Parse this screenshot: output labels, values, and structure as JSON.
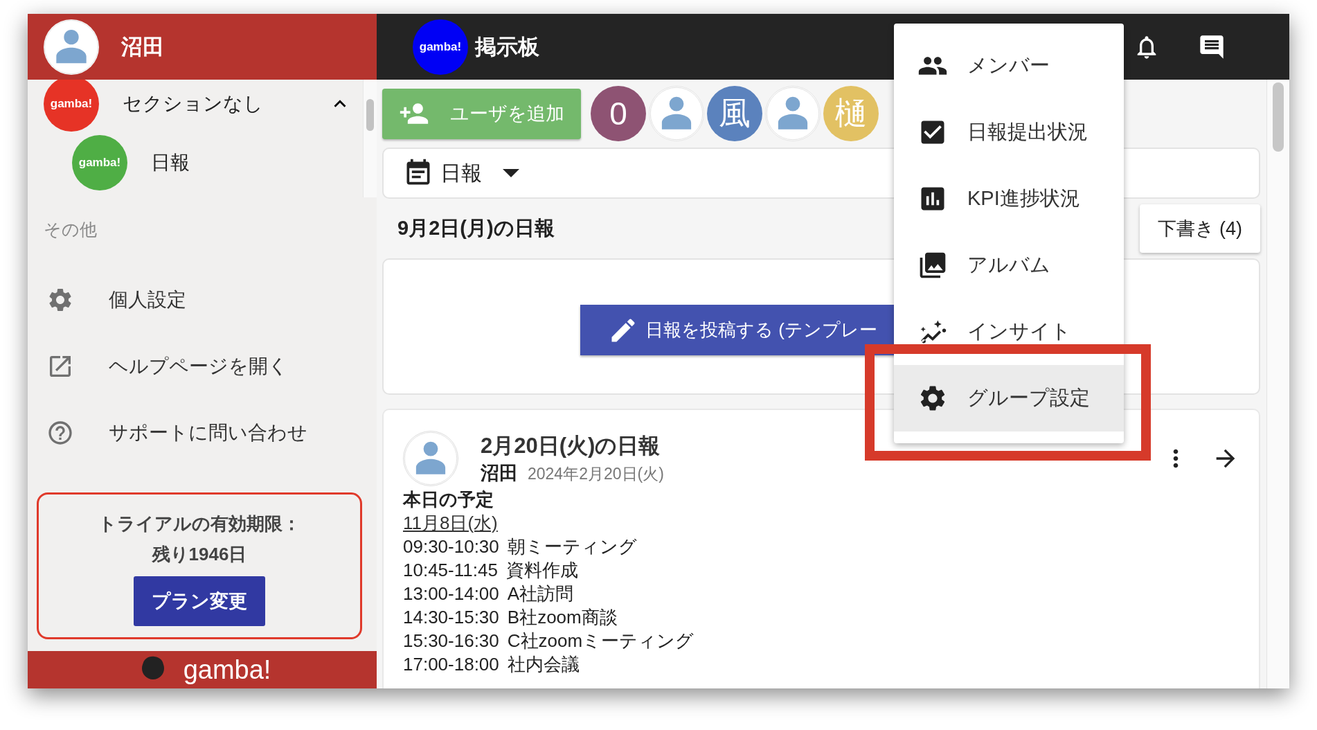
{
  "sidebar": {
    "user": {
      "name": "沼田"
    },
    "sections": [
      {
        "logo": "gamba!",
        "color": "#e63326",
        "label": "セクションなし",
        "expanded": true,
        "children": [
          {
            "logo": "gamba!",
            "color": "#4fae45",
            "label": "日報"
          }
        ]
      }
    ],
    "other_heading": "その他",
    "links": [
      {
        "label": "個人設定"
      },
      {
        "label": "ヘルプページを開く"
      },
      {
        "label": "サポートに問い合わせ"
      }
    ],
    "trial": {
      "lines": [
        "トライアルの有効期限：",
        "残り1946日"
      ],
      "button": "プラン変更"
    },
    "footer": {
      "brand": "gamba!"
    }
  },
  "header": {
    "logo": "gamba!",
    "title": "掲示板"
  },
  "toolbar": {
    "add_user": "ユーザを追加",
    "members": [
      {
        "kind": "letter",
        "text": "0",
        "color": "#8e5373"
      },
      {
        "kind": "image"
      },
      {
        "kind": "letter",
        "text": "風",
        "color": "#5b82bd"
      },
      {
        "kind": "image"
      },
      {
        "kind": "letter",
        "text": "樋",
        "color": "#e2c163"
      }
    ]
  },
  "filter": {
    "label": "日報"
  },
  "day": {
    "title": "9月2日(月)の日報",
    "drafts": "下書き (4)",
    "post_button": "日報を投稿する (テンプレー"
  },
  "entries": [
    {
      "title": "2月20日(火)の日報",
      "author": "沼田",
      "date": "2024年2月20日(火)",
      "heading": "本日の予定",
      "date_link": "11月8日(水)",
      "schedule": [
        {
          "time": "09:30-10:30",
          "text": "朝ミーティング"
        },
        {
          "time": "10:45-11:45",
          "text": "資料作成"
        },
        {
          "time": "13:00-14:00",
          "text": "A社訪問"
        },
        {
          "time": "14:30-15:30",
          "text": "B社zoom商談"
        },
        {
          "time": "15:30-16:30",
          "text": "C社zoomミーティング"
        },
        {
          "time": "17:00-18:00",
          "text": "社内会議"
        }
      ]
    }
  ],
  "menu": {
    "items": [
      {
        "label": "メンバー",
        "selected": false
      },
      {
        "label": "日報提出状況",
        "selected": false
      },
      {
        "label": "KPI進捗状況",
        "selected": false
      },
      {
        "label": "アルバム",
        "selected": false
      },
      {
        "label": "インサイト",
        "selected": false
      },
      {
        "label": "グループ設定",
        "selected": true
      }
    ]
  }
}
